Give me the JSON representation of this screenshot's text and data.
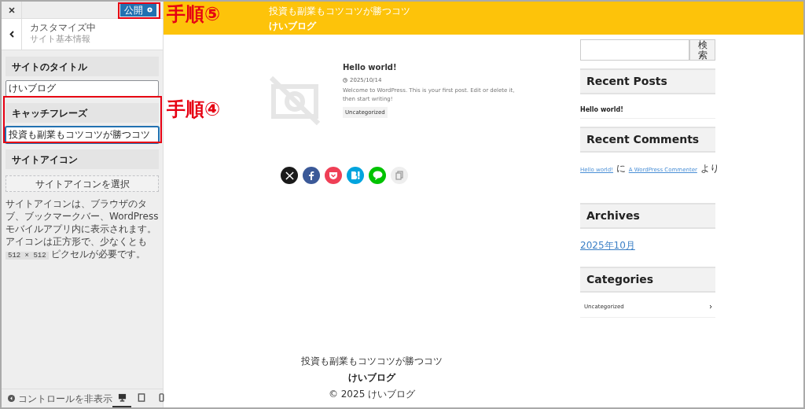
{
  "customizer": {
    "publish_button": "公開",
    "breadcrumb": "カスタマイズ中",
    "section_title": "サイト基本情報",
    "fields": [
      {
        "heading": "サイトのタイトル",
        "value": "けいブログ",
        "focused": false
      },
      {
        "heading": "キャッチフレーズ",
        "value": "投資も副業もコツコツが勝つコツ",
        "focused": true
      }
    ],
    "site_icon": {
      "heading": "サイトアイコン",
      "button": "サイトアイコンを選択",
      "description_before": "サイトアイコンは、ブラウザのタブ、ブックマークバー、WordPress モバイルアプリ内に表示されます。アイコンは正方形で、少なくとも",
      "size_code": "512 × 512",
      "description_after": "ピクセルが必要です。"
    },
    "hide_controls": "コントロールを非表示",
    "devices": [
      {
        "kind": "desktop",
        "selected": true
      },
      {
        "kind": "tablet",
        "selected": false
      },
      {
        "kind": "mobile",
        "selected": false
      }
    ]
  },
  "annotations": [
    {
      "label": "手順⑤"
    },
    {
      "label": "手順④"
    }
  ],
  "preview": {
    "header": {
      "tagline": "投資も副業もコツコツが勝つコツ",
      "site_title": "けいブログ"
    },
    "post": {
      "title": "Hello world!",
      "date": "2025/10/14",
      "excerpt": "Welcome to WordPress. This is your first post. Edit or delete it, then start writing!",
      "category": "Uncategorized"
    },
    "share_buttons": [
      {
        "kind": "x",
        "color": "#1a1a1a"
      },
      {
        "kind": "facebook",
        "color": "#3b5998"
      },
      {
        "kind": "pocket",
        "color": "#ef3f56"
      },
      {
        "kind": "hatena",
        "color": "#00a4de"
      },
      {
        "kind": "line",
        "color": "#00c300"
      },
      {
        "kind": "copy",
        "color": "#eeeeee"
      }
    ],
    "sidebar": {
      "search_button": "検索",
      "recent_posts": {
        "title": "Recent Posts",
        "items": [
          "Hello world!"
        ]
      },
      "recent_comments": {
        "title": "Recent Comments",
        "link1": "Hello world!",
        "middle": "に",
        "link2": "A WordPress Commenter",
        "end": "より"
      },
      "archives": {
        "title": "Archives",
        "items": [
          "2025年10月"
        ]
      },
      "categories": {
        "title": "Categories",
        "items": [
          "Uncategorized"
        ]
      }
    },
    "footer": {
      "tagline": "投資も副業もコツコツが勝つコツ",
      "site_title": "けいブログ",
      "copyright": "© 2025 けいブログ"
    }
  }
}
